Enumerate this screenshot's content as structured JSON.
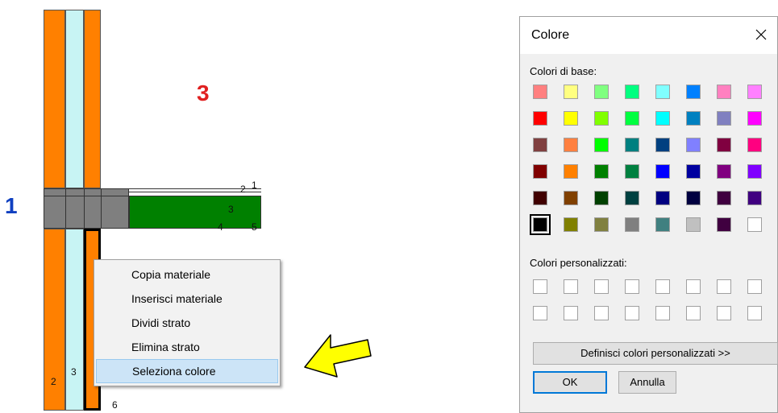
{
  "drawing": {
    "labels": {
      "side_left": "1",
      "side_right": "3",
      "layer_2": "2",
      "layer_3": "3",
      "node_6": "6",
      "slab_1": "1",
      "slab_2": "2",
      "slab_3": "3",
      "slab_4": "4",
      "slab_5": "5"
    },
    "colors": {
      "orange": "#ff8000",
      "light_cyan": "#c8f4f4",
      "gray": "#7f7f7f",
      "green": "#008000",
      "red_label": "#e02020",
      "blue_label": "#1040c0"
    }
  },
  "context_menu": {
    "items": [
      {
        "label": "Copia materiale"
      },
      {
        "label": "Inserisci materiale"
      },
      {
        "label": "Dividi strato"
      },
      {
        "label": "Elimina strato"
      },
      {
        "label": "Seleziona colore",
        "selected": true
      }
    ]
  },
  "arrow": {
    "color": "#ffff00"
  },
  "color_dialog": {
    "title": "Colore",
    "basic_colors_label": "Colori di base:",
    "custom_colors_label": "Colori personalizzati:",
    "define_custom_button": "Definisci colori personalizzati >>",
    "ok_button": "OK",
    "cancel_button": "Annulla",
    "basic_colors": [
      [
        "#ff8080",
        "#ffff80",
        "#80ff80",
        "#00ff80",
        "#80ffff",
        "#0080ff",
        "#ff80c0",
        "#ff80ff"
      ],
      [
        "#ff0000",
        "#ffff00",
        "#80ff00",
        "#00ff40",
        "#00ffff",
        "#0080c0",
        "#8080c0",
        "#ff00ff"
      ],
      [
        "#804040",
        "#ff8040",
        "#00ff00",
        "#008080",
        "#004080",
        "#8080ff",
        "#800040",
        "#ff0080"
      ],
      [
        "#800000",
        "#ff8000",
        "#008000",
        "#008040",
        "#0000ff",
        "#0000a0",
        "#800080",
        "#8000ff"
      ],
      [
        "#400000",
        "#804000",
        "#004000",
        "#004040",
        "#000080",
        "#000040",
        "#400040",
        "#400080"
      ],
      [
        "#000000",
        "#808000",
        "#808040",
        "#808080",
        "#408080",
        "#c0c0c0",
        "#400040",
        "#ffffff"
      ]
    ],
    "selected_color": "#000000",
    "custom_colors": [
      [
        "#ffffff",
        "#ffffff",
        "#ffffff",
        "#ffffff",
        "#ffffff",
        "#ffffff",
        "#ffffff",
        "#ffffff"
      ],
      [
        "#ffffff",
        "#ffffff",
        "#ffffff",
        "#ffffff",
        "#ffffff",
        "#ffffff",
        "#ffffff",
        "#ffffff"
      ]
    ]
  }
}
